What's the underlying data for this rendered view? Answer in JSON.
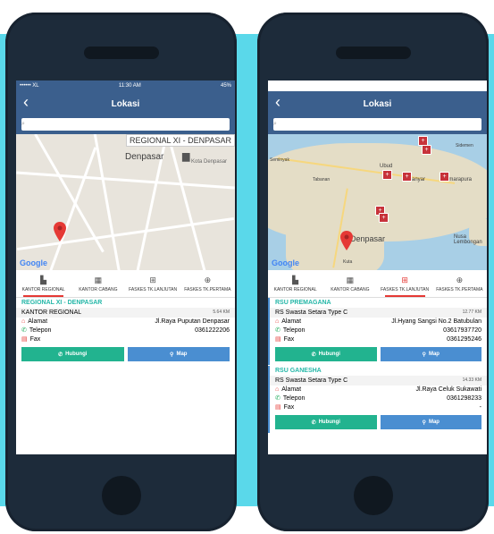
{
  "left": {
    "status": {
      "carrier": "•••••• XL ",
      "time": "11:30 AM",
      "battery": "45%"
    },
    "nav_title": "Lokasi",
    "search_placeholder": "",
    "region_banner": "REGIONAL XI - DENPASAR",
    "map_city": "Denpasar",
    "map_poi": "Kota Denpasar",
    "google": "Google",
    "tabs": [
      {
        "label": "KANTOR REGIONAL",
        "icon": "building-icon"
      },
      {
        "label": "KANTOR CABANG",
        "icon": "office-icon"
      },
      {
        "label": "FASKES TK.LANJUTAN",
        "icon": "hospital-icon"
      },
      {
        "label": "FASKES TK.PERTAMA",
        "icon": "clinic-icon"
      }
    ],
    "active_tab": 0,
    "section": "REGIONAL XI - DENPASAR",
    "item_title": "KANTOR REGIONAL",
    "item_dist": "5.64 KM",
    "alamat_label": "Alamat",
    "alamat": "Jl.Raya Puputan Denpasar",
    "telepon_label": "Telepon",
    "telepon": "0361222206",
    "fax_label": "Fax",
    "fax": "",
    "hubungi": "Hubungi",
    "map_btn": "Map"
  },
  "right": {
    "nav_title": "Lokasi",
    "search_placeholder": "",
    "map_labels": [
      "Seminyak",
      "Tabanan",
      "Gianyar",
      "Semarapura",
      "Ubud",
      "Denpasar",
      "Kuta",
      "Nusa Lembongan",
      "Sidemen"
    ],
    "google": "Google",
    "tabs": [
      {
        "label": "KANTOR REGIONAL",
        "icon": "building-icon"
      },
      {
        "label": "KANTOR CABANG",
        "icon": "office-icon"
      },
      {
        "label": "FASKES TK.LANJUTAN",
        "icon": "hospital-icon"
      },
      {
        "label": "FASKES TK.PERTAMA",
        "icon": "clinic-icon"
      }
    ],
    "active_tab": 2,
    "cards": [
      {
        "section": "RSU PREMAGANA",
        "type": "RS Swasta Setara Type C",
        "dist": "12.77 KM",
        "alamat_label": "Alamat",
        "alamat": "Jl.Hyang Sangsi No.2 Batubulan",
        "telepon_label": "Telepon",
        "telepon": "03617937720",
        "fax_label": "Fax",
        "fax": "0361295246",
        "hubungi": "Hubungi",
        "map_btn": "Map"
      },
      {
        "section": "RSU GANESHA",
        "type": "RS Swasta Setara Type C",
        "dist": "14.33 KM",
        "alamat_label": "Alamat",
        "alamat": "Jl.Raya Celuk Sukawati",
        "telepon_label": "Telepon",
        "telepon": "0361298233",
        "fax_label": "Fax",
        "fax": "-",
        "hubungi": "Hubungi",
        "map_btn": "Map"
      }
    ]
  },
  "colors": {
    "navbar": "#3b5f8d",
    "accent_green": "#22b38f",
    "accent_blue": "#4a8ed1",
    "tab_active": "#e53935",
    "section_text": "#25b7a8",
    "background_stripe": "#5ad8ea"
  }
}
